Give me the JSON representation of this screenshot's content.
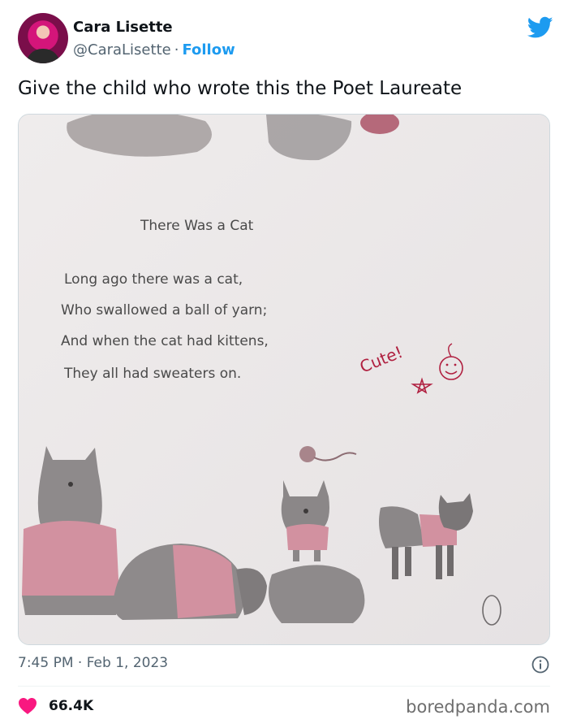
{
  "author": {
    "name": "Cara Lisette",
    "handle": "@CaraLisette",
    "separator": "·",
    "follow_label": "Follow",
    "avatar_icon": "profile-avatar"
  },
  "platform_icon": "twitter-bird-icon",
  "tweet": {
    "text": "Give the child who wrote this the Poet Laureate",
    "time": "7:45 PM · Feb 1, 2023"
  },
  "media": {
    "poem_title": "There Was a Cat",
    "poem_lines": [
      "Long ago there was a cat,",
      "Who swallowed a ball of yarn;",
      "And when the cat had kittens,",
      "They all had sweaters on."
    ],
    "teacher_note": "Cute!",
    "teacher_note_color": "#b02040"
  },
  "engagement": {
    "likes": "66.4K",
    "heart_color": "#f91880"
  },
  "watermark": "boredpanda.com",
  "colors": {
    "accent": "#1d9bf0",
    "text": "#0f1419",
    "muted": "#536471"
  }
}
